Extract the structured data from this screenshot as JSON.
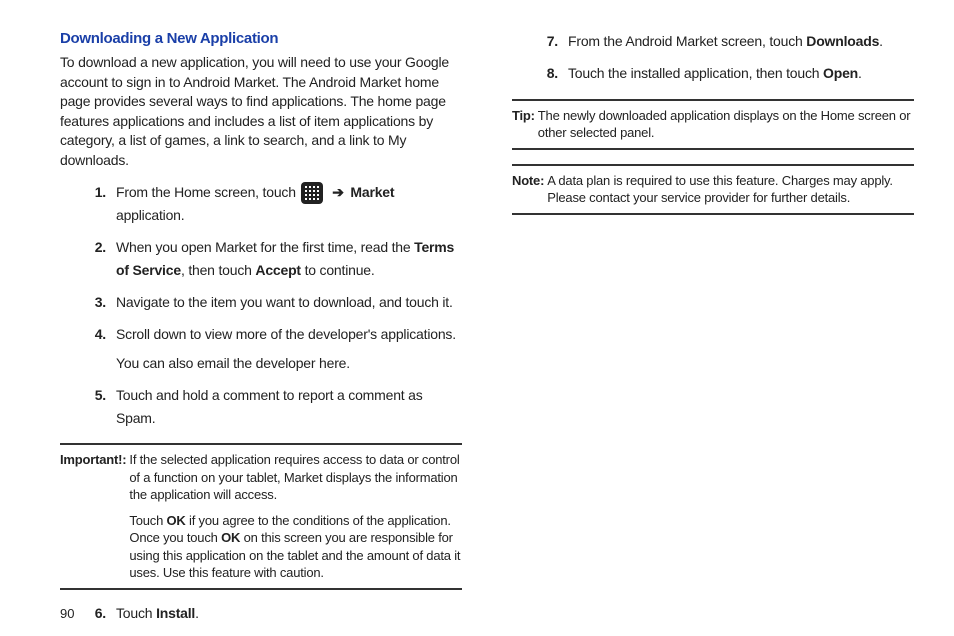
{
  "left": {
    "heading": "Downloading a New Application",
    "intro": "To download a new application, you will need to use your Google account to sign in to Android Market. The Android Market home page provides several ways to find applications. The home page features applications and includes a list of item applications by category, a list of games, a link to search, and a link to My downloads.",
    "steps": {
      "s1a": "From the Home screen, touch ",
      "s1b": " application.",
      "s1_market": "Market",
      "s2a": "When you open Market for the first time, read the ",
      "s2_tos": "Terms of Service",
      "s2b": ", then touch ",
      "s2_accept": "Accept",
      "s2c": " to continue.",
      "s3": "Navigate to the item you want to download, and touch it.",
      "s4a": "Scroll down to view more of the developer's applications.",
      "s4b": "You can also email the developer here.",
      "s5": "Touch and hold a comment to report a comment as Spam.",
      "s6a": "Touch ",
      "s6_install": "Install",
      "s6b": "."
    },
    "important": {
      "label": "Important!:",
      "p1": "If the selected application requires access to data or control of a function on your tablet, Market displays the information the application will access.",
      "p2a": "Touch ",
      "p2_ok1": "OK",
      "p2b": " if you agree to the conditions of the application. Once you touch ",
      "p2_ok2": "OK",
      "p2c": " on this screen you are responsible for using this application on the tablet and the amount of data it uses. Use this feature with caution."
    }
  },
  "right": {
    "steps": {
      "s7a": "From the Android Market screen, touch ",
      "s7_dl": "Downloads",
      "s7b": ".",
      "s8a": "Touch the installed application, then touch ",
      "s8_open": "Open",
      "s8b": "."
    },
    "tip": {
      "label": "Tip:",
      "body": "The newly downloaded application displays on the Home screen or other selected panel."
    },
    "note": {
      "label": "Note:",
      "body": " A data plan is required to use this feature. Charges may apply. Please contact your service provider for further details."
    }
  },
  "pageNum": "90",
  "nums": {
    "n1": "1.",
    "n2": "2.",
    "n3": "3.",
    "n4": "4.",
    "n5": "5.",
    "n6": "6.",
    "n7": "7.",
    "n8": "8."
  },
  "arrow": "➔"
}
